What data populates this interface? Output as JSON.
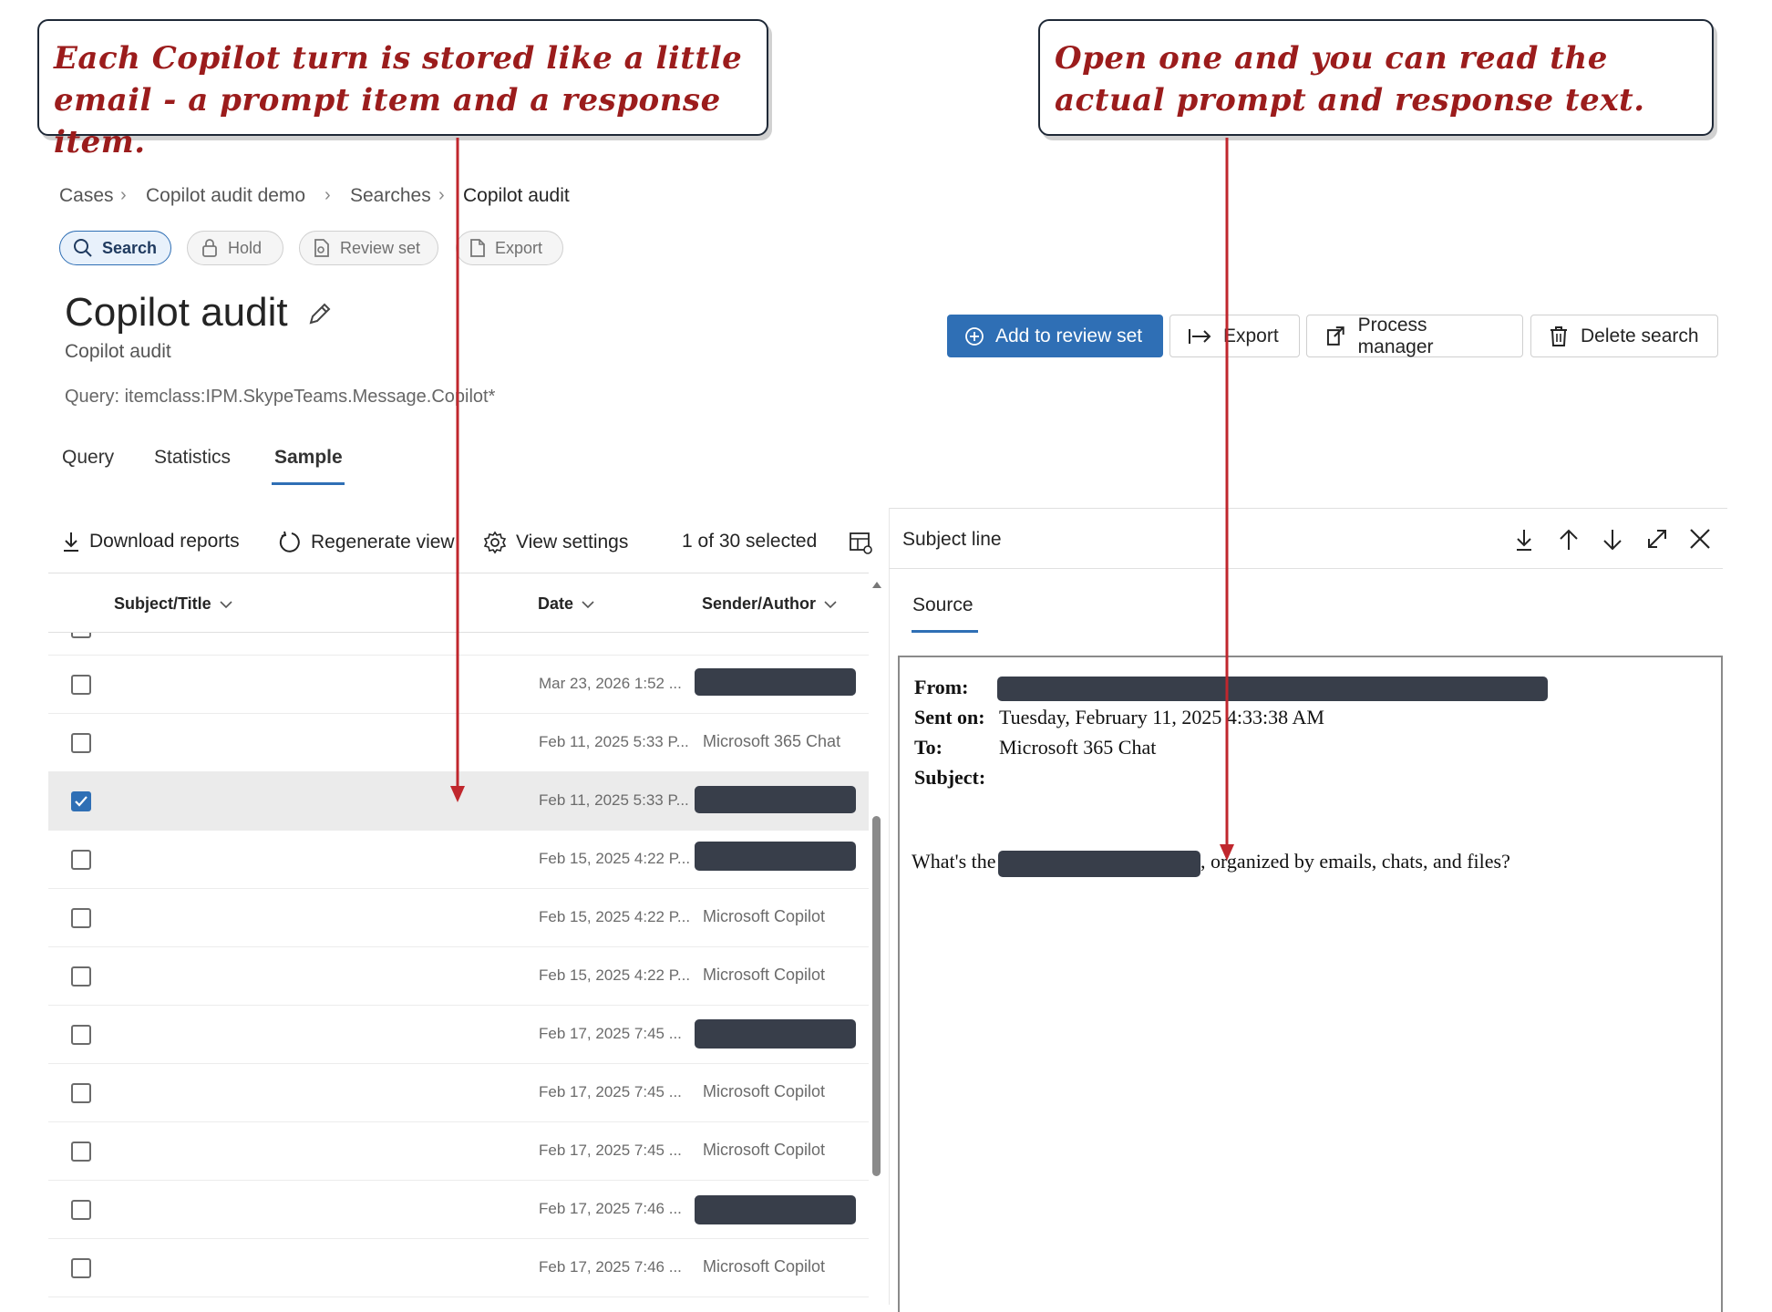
{
  "callouts": {
    "left": "Each Copilot turn is stored like a little email - a prompt item and a response item.",
    "right": "Open one and you can read the actual prompt and response text."
  },
  "breadcrumb": [
    "Cases",
    "Copilot audit demo",
    "Searches",
    "Copilot audit"
  ],
  "top_tabs": {
    "search": "Search",
    "hold": "Hold",
    "review_set": "Review set",
    "export": "Export"
  },
  "page": {
    "title": "Copilot audit",
    "subtitle": "Copilot audit",
    "query": "Query: itemclass:IPM.SkypeTeams.Message.Copilot*"
  },
  "actions": {
    "add_to_review_set": "Add to review set",
    "export": "Export",
    "process_manager": "Process manager",
    "delete_search": "Delete search"
  },
  "section_tabs": {
    "query": "Query",
    "statistics": "Statistics",
    "sample": "Sample"
  },
  "toolbar": {
    "download_reports": "Download reports",
    "regenerate_view": "Regenerate view",
    "view_settings": "View settings",
    "selection_count": "1 of 30 selected"
  },
  "table": {
    "columns": {
      "subject": "Subject/Title",
      "date": "Date",
      "sender": "Sender/Author"
    },
    "rows": [
      {
        "date": "Mar 23, 2026 1:52 ...",
        "sender": ""
      },
      {
        "date": "Feb 11, 2025 5:33 P...",
        "sender": "Microsoft 365 Chat"
      },
      {
        "date": "Feb 11, 2025 5:33 P...",
        "sender": ""
      },
      {
        "date": "Feb 15, 2025 4:22 P...",
        "sender": ""
      },
      {
        "date": "Feb 15, 2025 4:22 P...",
        "sender": "Microsoft Copilot"
      },
      {
        "date": "Feb 15, 2025 4:22 P...",
        "sender": "Microsoft Copilot"
      },
      {
        "date": "Feb 17, 2025 7:45 ...",
        "sender": ""
      },
      {
        "date": "Feb 17, 2025 7:45 ...",
        "sender": "Microsoft Copilot"
      },
      {
        "date": "Feb 17, 2025 7:45 ...",
        "sender": "Microsoft Copilot"
      },
      {
        "date": "Feb 17, 2025 7:46 ...",
        "sender": ""
      },
      {
        "date": "Feb 17, 2025 7:46 ...",
        "sender": "Microsoft Copilot"
      }
    ]
  },
  "panel": {
    "title": "Subject line",
    "tab": "Source",
    "from_label": "From:",
    "sent_label": "Sent on:",
    "sent_value": "Tuesday, February 11, 2025 4:33:38 AM",
    "to_label": "To:",
    "to_value": "Microsoft 365 Chat",
    "subject_label": "Subject:",
    "body_start": "What's the",
    "body_end": ", organized by emails, chats, and files?"
  },
  "colors": {
    "accent": "#2f6fb5",
    "callout_text": "#9b1c1c",
    "arrow": "#c0272d",
    "redaction": "#383e4a"
  }
}
